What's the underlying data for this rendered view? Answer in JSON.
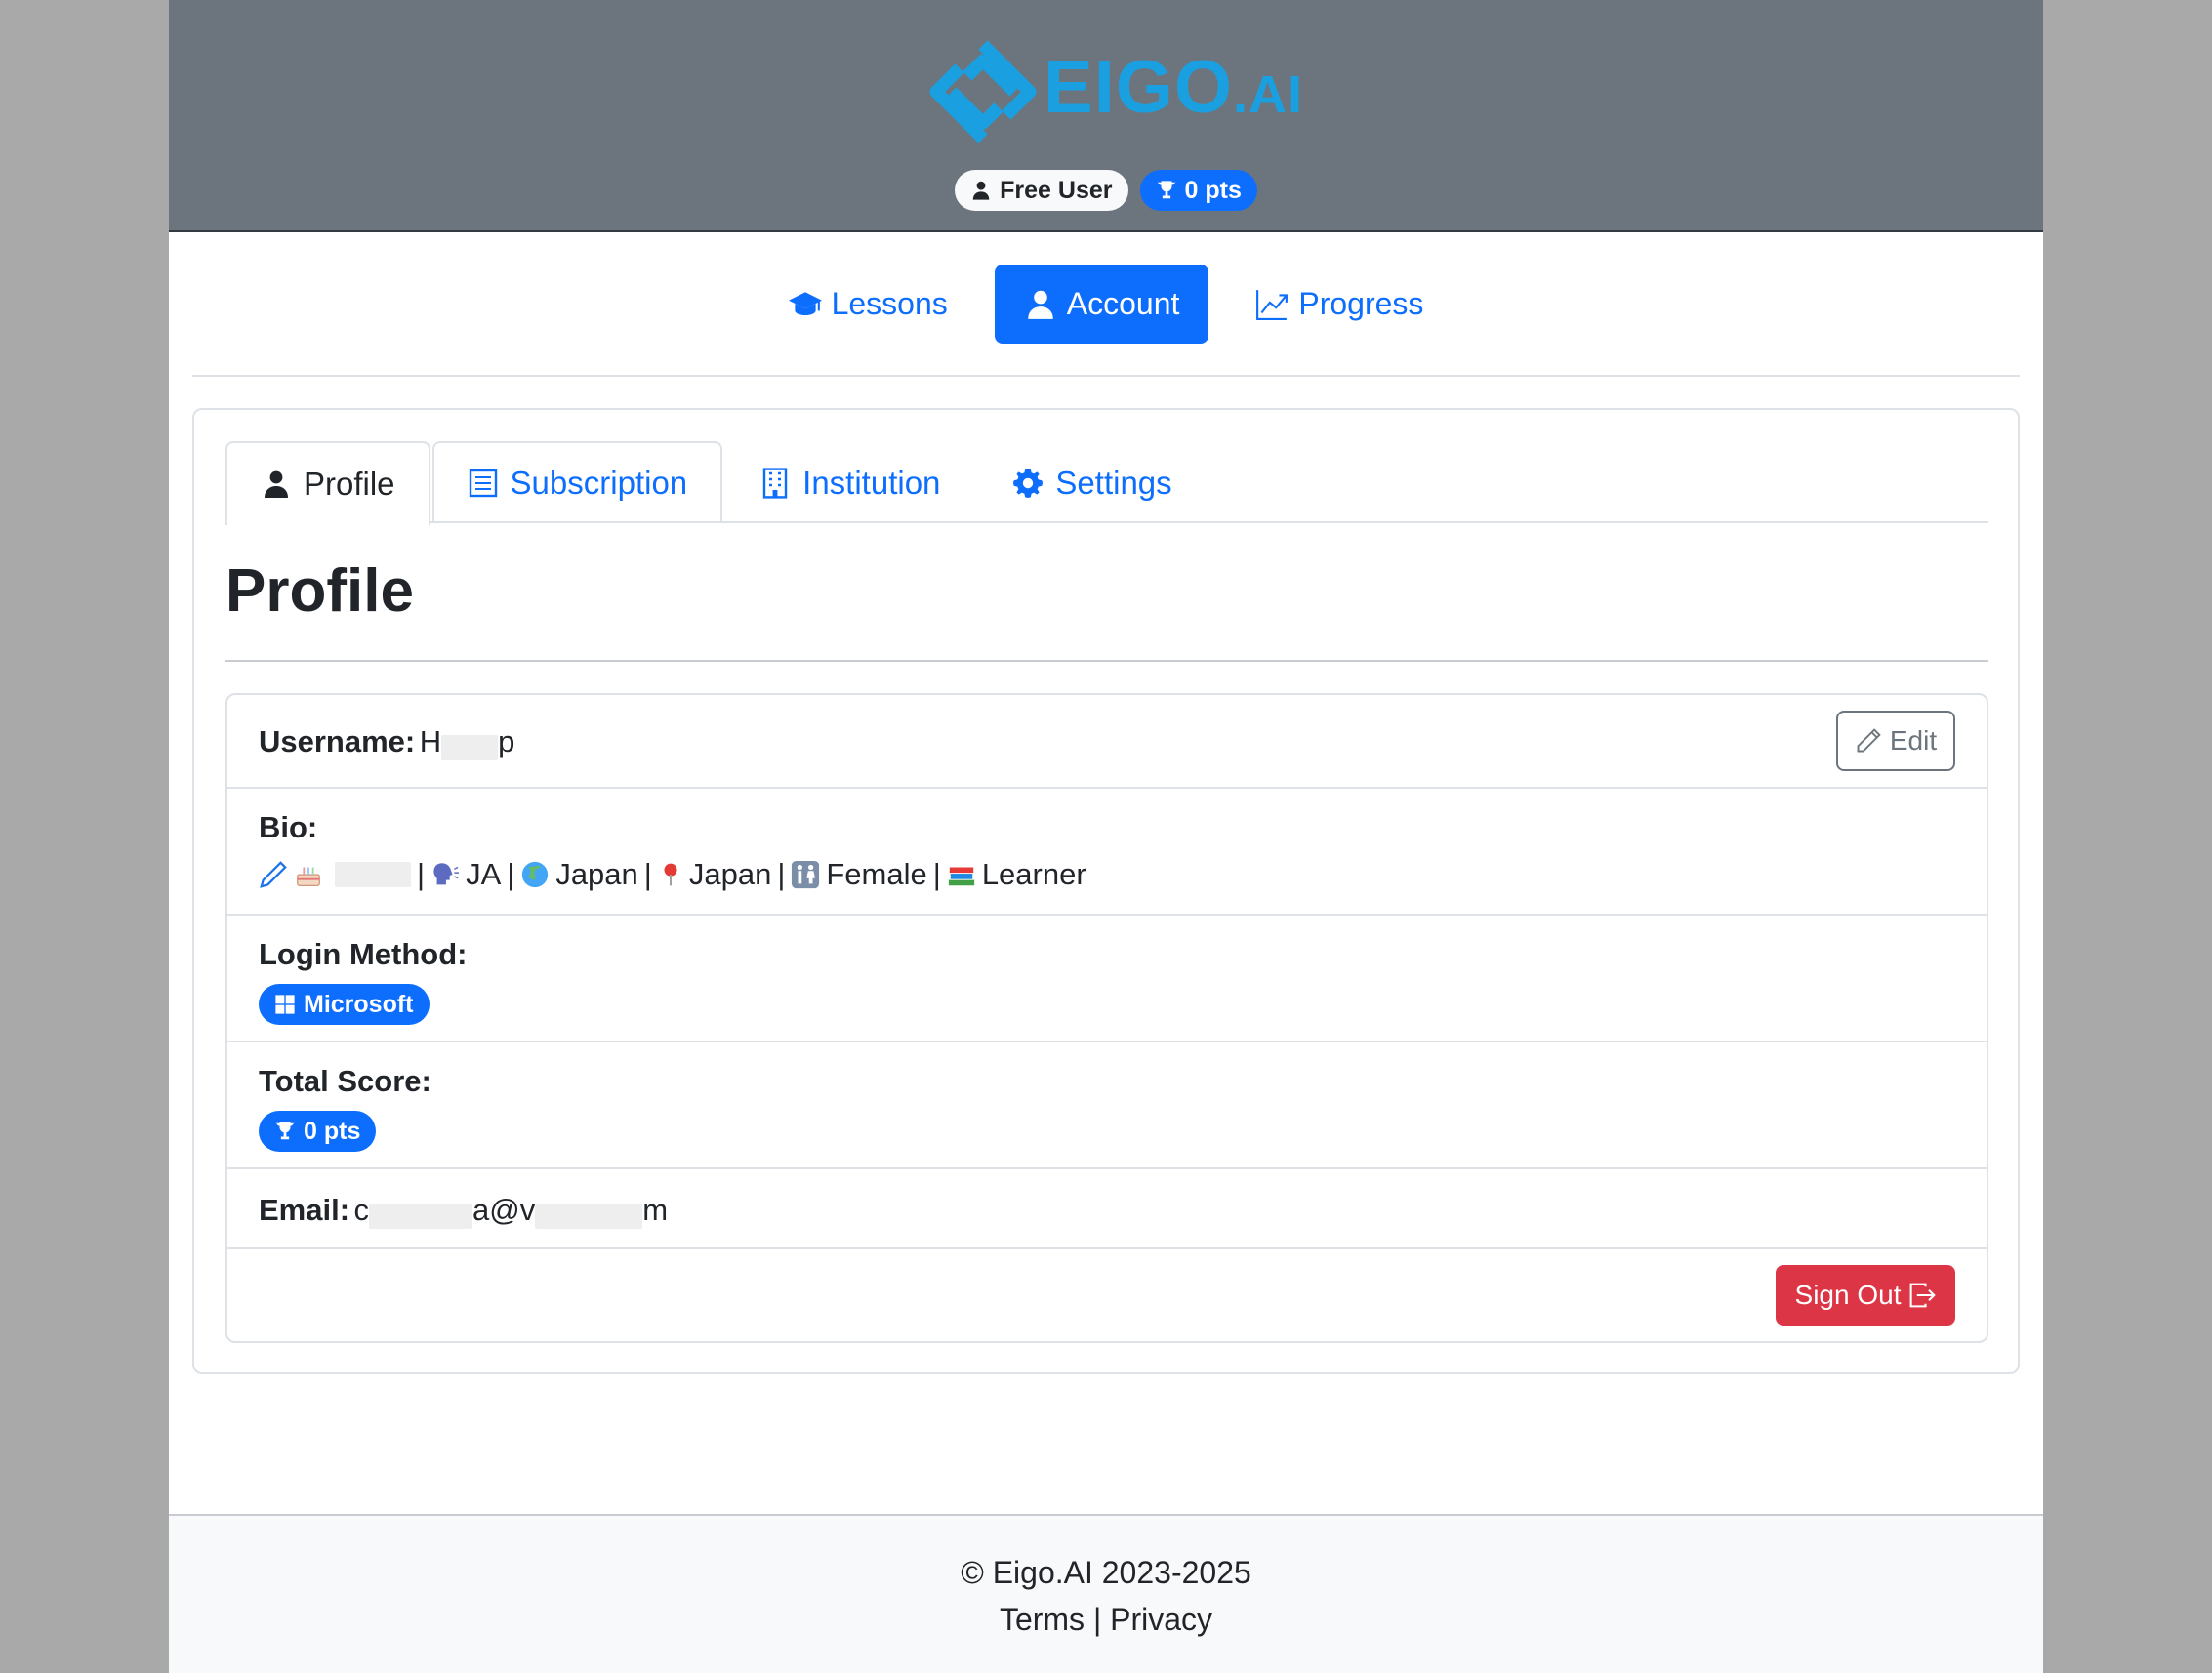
{
  "header": {
    "logo_text": "EIGO",
    "logo_suffix": ".AI",
    "user_badge": "Free User",
    "points_badge": "0 pts",
    "brand_color": "#1a9fe0"
  },
  "mainnav": {
    "lessons": "Lessons",
    "account": "Account",
    "progress": "Progress"
  },
  "tabs": {
    "profile": "Profile",
    "subscription": "Subscription",
    "institution": "Institution",
    "settings": "Settings"
  },
  "page_title": "Profile",
  "profile": {
    "username_label": "Username:",
    "username_start": "H",
    "username_end": "p",
    "edit_label": "Edit",
    "bio_label": "Bio:",
    "bio": {
      "lang": "JA",
      "country": "Japan",
      "location": "Japan",
      "gender": "Female",
      "role": "Learner",
      "sep": "|"
    },
    "login_label": "Login Method:",
    "login_method": "Microsoft",
    "score_label": "Total Score:",
    "score_value": "0 pts",
    "email_label": "Email:",
    "email_start": "c",
    "email_mid": "a@v",
    "email_end": "m",
    "signout_label": "Sign Out"
  },
  "footer": {
    "copyright": "© Eigo.AI 2023-2025",
    "terms": "Terms",
    "separator": "|",
    "privacy": "Privacy"
  },
  "colors": {
    "primary": "#0d6efd",
    "danger": "#dc3545",
    "header_bg": "#6c757d"
  }
}
